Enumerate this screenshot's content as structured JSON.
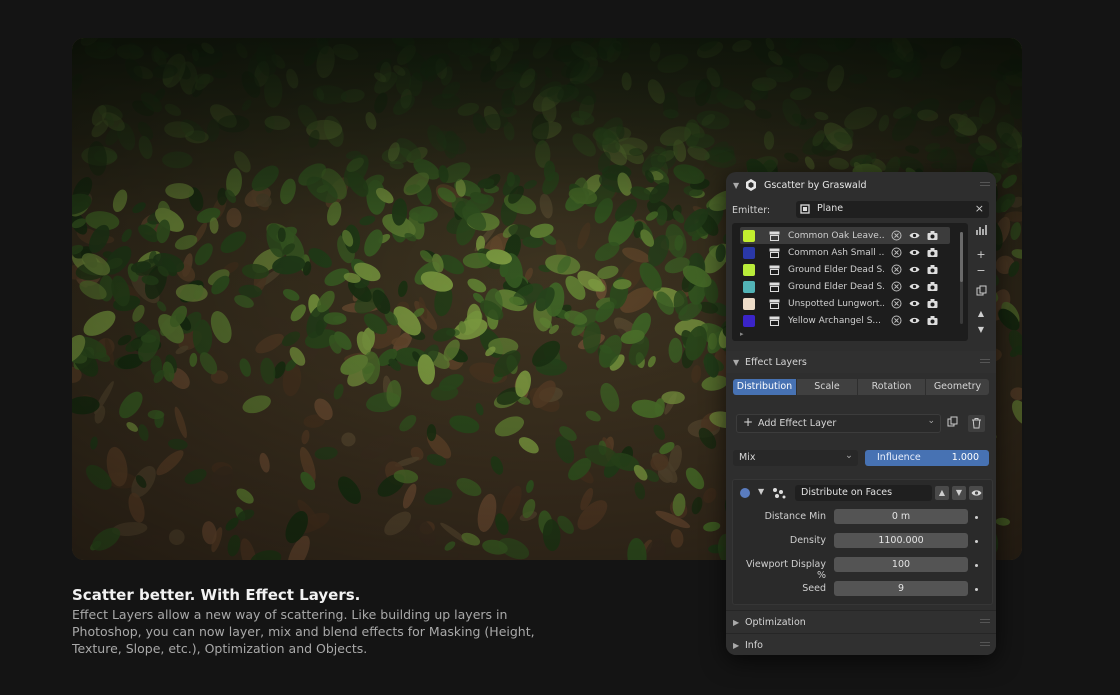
{
  "caption": {
    "title": "Scatter better. With Effect Layers.",
    "body": "Effect Layers allow a new way of scattering. Like building up layers in Photoshop, you can now layer, mix and blend effects for Masking (Height, Texture, Slope, etc.), Optimization and Objects."
  },
  "panel": {
    "title": "Gscatter by Graswald",
    "emitter_label": "Emitter:",
    "emitter_value": "Plane",
    "scatter_list": [
      {
        "name": "Common Oak Leave...",
        "color": "#c3ef2f"
      },
      {
        "name": "Common Ash Small ...",
        "color": "#2a38a8"
      },
      {
        "name": "Ground Elder Dead S...",
        "color": "#b9ec3a"
      },
      {
        "name": "Ground Elder Dead S...",
        "color": "#52b3b6"
      },
      {
        "name": "Unspotted Lungwort...",
        "color": "#eddcc8"
      },
      {
        "name": "Yellow Archangel S...",
        "color": "#3a24c9"
      }
    ],
    "effect_layers": {
      "header": "Effect Layers",
      "tabs": [
        "Distribution",
        "Scale",
        "Rotation",
        "Geometry"
      ],
      "active_tab": "Distribution",
      "add_label": "Add Effect Layer",
      "blend_mode": "Mix",
      "influence_label": "Influence",
      "influence_value": "1.000",
      "layer_name": "Distribute on Faces",
      "params": [
        {
          "label": "Distance Min",
          "value": "0 m"
        },
        {
          "label": "Density",
          "value": "1100.000"
        },
        {
          "label": "Viewport Display %",
          "value": "100"
        },
        {
          "label": "Seed",
          "value": "9"
        }
      ]
    },
    "optimization_header": "Optimization",
    "info_header": "Info"
  },
  "colors": {
    "accent": "#4772b3",
    "panel_bg": "#2e2e2e",
    "page_bg": "#141414"
  }
}
